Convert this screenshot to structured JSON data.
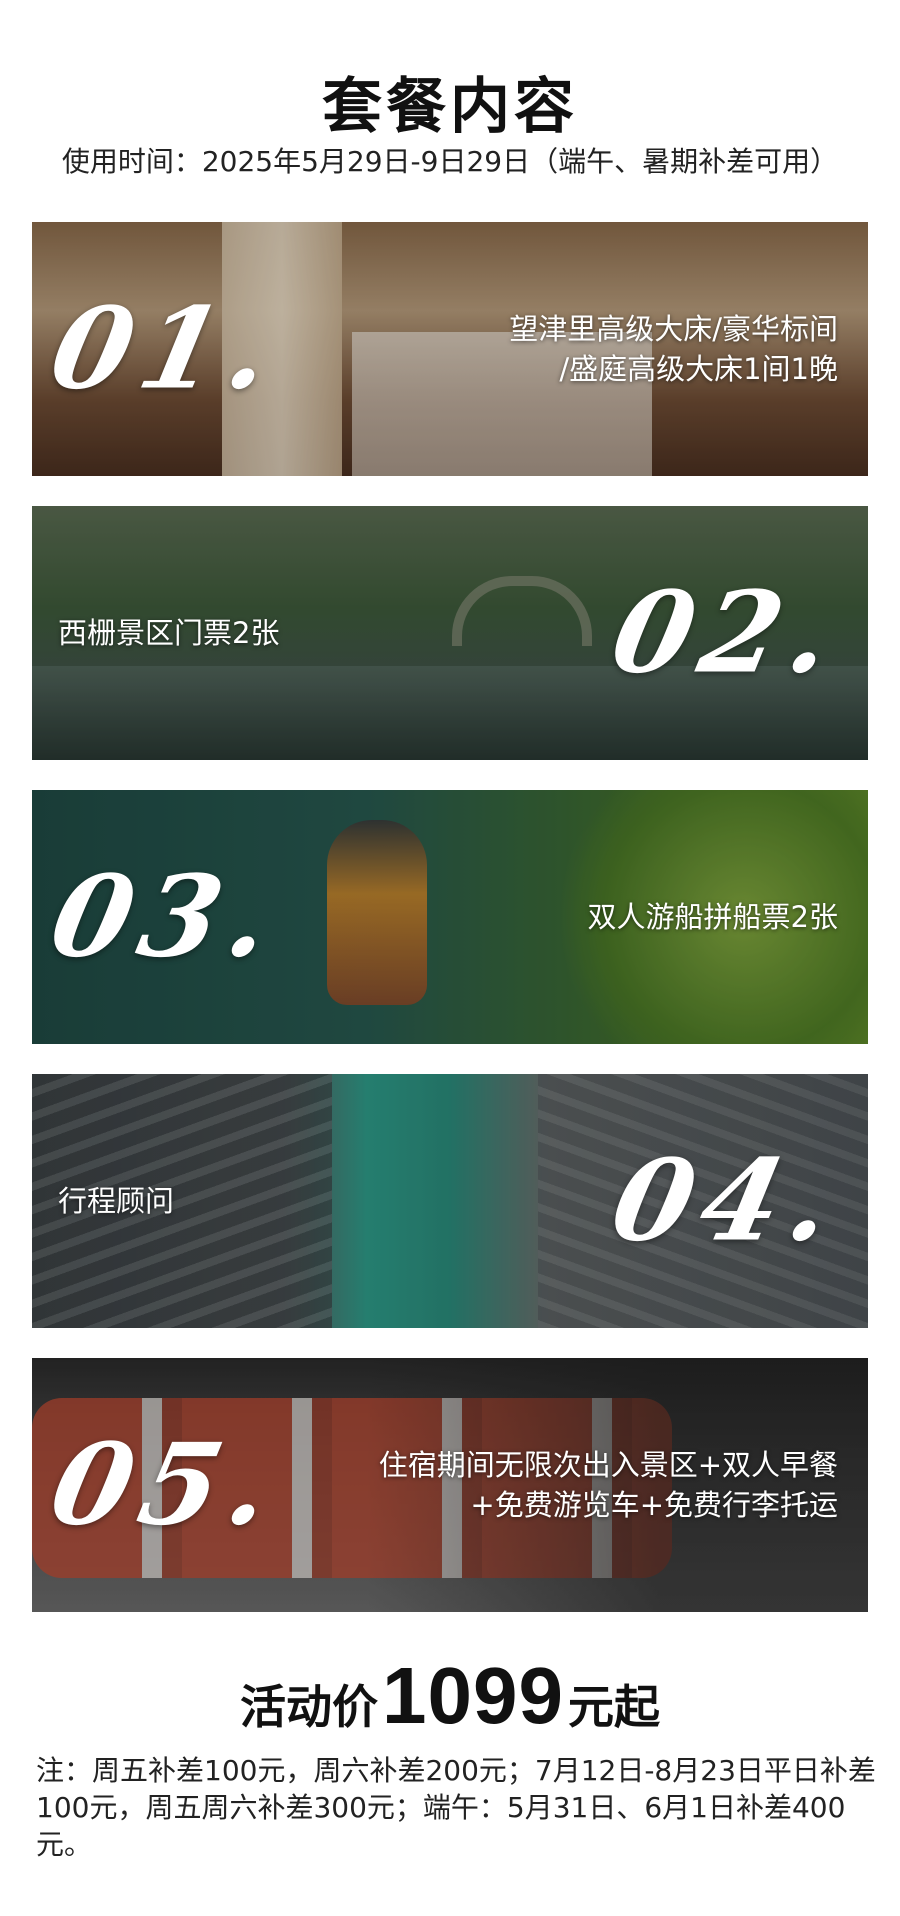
{
  "header": {
    "title": "套餐内容",
    "subtitle": "使用时间：2025年5月29日-9日29日（端午、暑期补差可用）"
  },
  "items": [
    {
      "number": "01.",
      "lines": [
        "望津里高级大床/豪华标间",
        "/盛庭高级大床1间1晚"
      ]
    },
    {
      "number": "02.",
      "lines": [
        "西栅景区门票2张"
      ]
    },
    {
      "number": "03.",
      "lines": [
        "双人游船拼船票2张"
      ]
    },
    {
      "number": "04.",
      "lines": [
        "行程顾问"
      ]
    },
    {
      "number": "05.",
      "lines": [
        "住宿期间无限次出入景区+双人早餐",
        "+免费游览车+免费行李托运"
      ]
    }
  ],
  "price": {
    "prefix": "活动价",
    "amount": "1099",
    "suffix": "元起"
  },
  "note": "注：周五补差100元，周六补差200元；7月12日-8月23日平日补差100元，周五周六补差300元；端午：5月31日、6月1日补差400元。"
}
